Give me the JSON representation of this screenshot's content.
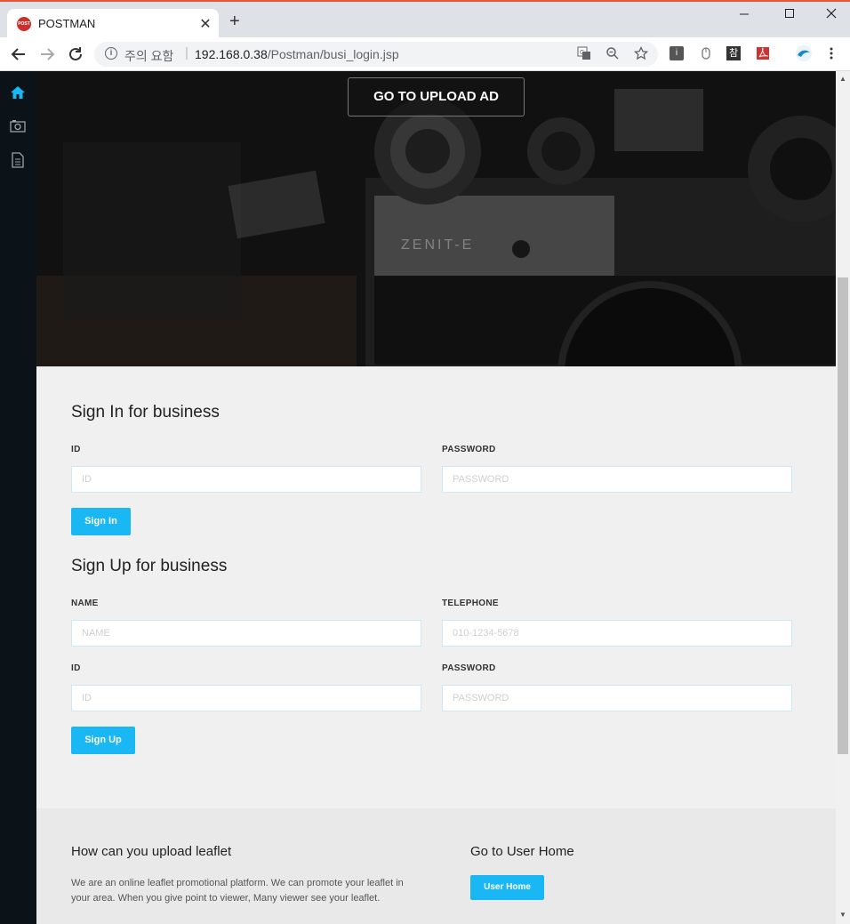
{
  "browser": {
    "tab_title": "POSTMAN",
    "favicon_text": "POST",
    "new_tab": "+",
    "security_text": "주의 요함",
    "url_host": "192.168.0.38",
    "url_path": "/Postman/busi_login.jsp",
    "ext_text": "참"
  },
  "sidebar": {
    "items": [
      {
        "icon": "home-icon",
        "active_color": "#1ab7f5"
      },
      {
        "icon": "camera-icon"
      },
      {
        "icon": "document-icon"
      }
    ]
  },
  "hero": {
    "upload_button": "GO TO UPLOAD AD",
    "camera_brand": "ZENIT-E"
  },
  "sign_in": {
    "title": "Sign In for business",
    "id_label": "ID",
    "id_placeholder": "ID",
    "password_label": "PASSWORD",
    "password_placeholder": "PASSWORD",
    "button": "Sign In"
  },
  "sign_up": {
    "title": "Sign Up for business",
    "name_label": "NAME",
    "name_placeholder": "NAME",
    "telephone_label": "TELEPHONE",
    "telephone_placeholder": "010-1234-5678",
    "id_label": "ID",
    "id_placeholder": "ID",
    "password_label": "PASSWORD",
    "password_placeholder": "PASSWORD",
    "button": "Sign Up"
  },
  "footer": {
    "left_title": "How can you upload leaflet",
    "left_text": "We are an online leaflet promotional platform. We can promote your leaflet in your area. When you give point to viewer, Many viewer see your leaflet.",
    "right_title": "Go to User Home",
    "right_button": "User Home"
  },
  "colors": {
    "accent": "#1ab7f5",
    "sidebar_bg": "#0b1318",
    "content_bg": "#f0f0f0"
  }
}
